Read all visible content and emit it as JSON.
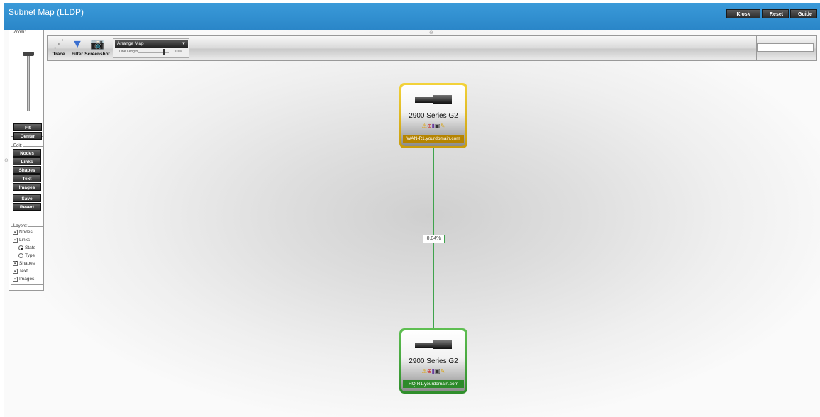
{
  "window": {
    "title": "Subnet Map (LLDP)"
  },
  "header_buttons": {
    "kiosk": "Kiosk",
    "reset": "Reset",
    "guide": "Guide"
  },
  "left_panel": {
    "zoom_legend": "Zoom:",
    "zoom_buttons": {
      "fit": "Fit",
      "center": "Center"
    },
    "edit_legend": "Edit:",
    "edit_buttons": [
      "Nodes",
      "Links",
      "Shapes",
      "Text",
      "Images"
    ],
    "save": "Save",
    "revert": "Revert",
    "layers_legend": "Layers:",
    "layers": {
      "nodes": "Nodes",
      "links": "Links",
      "state": "State",
      "type": "Type",
      "shapes": "Shapes",
      "text": "Text",
      "images": "Images"
    }
  },
  "toolbar": {
    "trace": "Trace",
    "filter": "Filter",
    "screenshot": "Screenshot",
    "arrange_selected": "Arrange Map",
    "line_length_label": "Line Length",
    "line_length_value": "100%",
    "search_value": ""
  },
  "map": {
    "link_label": "0.04%",
    "nodes": [
      {
        "model": "2900 Series G2",
        "hostname": "WAN-R1.yourdomain.com",
        "status_color": "#e8c21f"
      },
      {
        "model": "2900 Series G2",
        "hostname": "HQ-R1.yourdomain.com",
        "status_color": "#3e9e37"
      }
    ]
  },
  "icons": [
    "trace-icon",
    "filter-icon",
    "camera-icon",
    "warning-icon",
    "lifesaver-icon",
    "graph-icon",
    "printer-icon",
    "wrench-icon"
  ]
}
